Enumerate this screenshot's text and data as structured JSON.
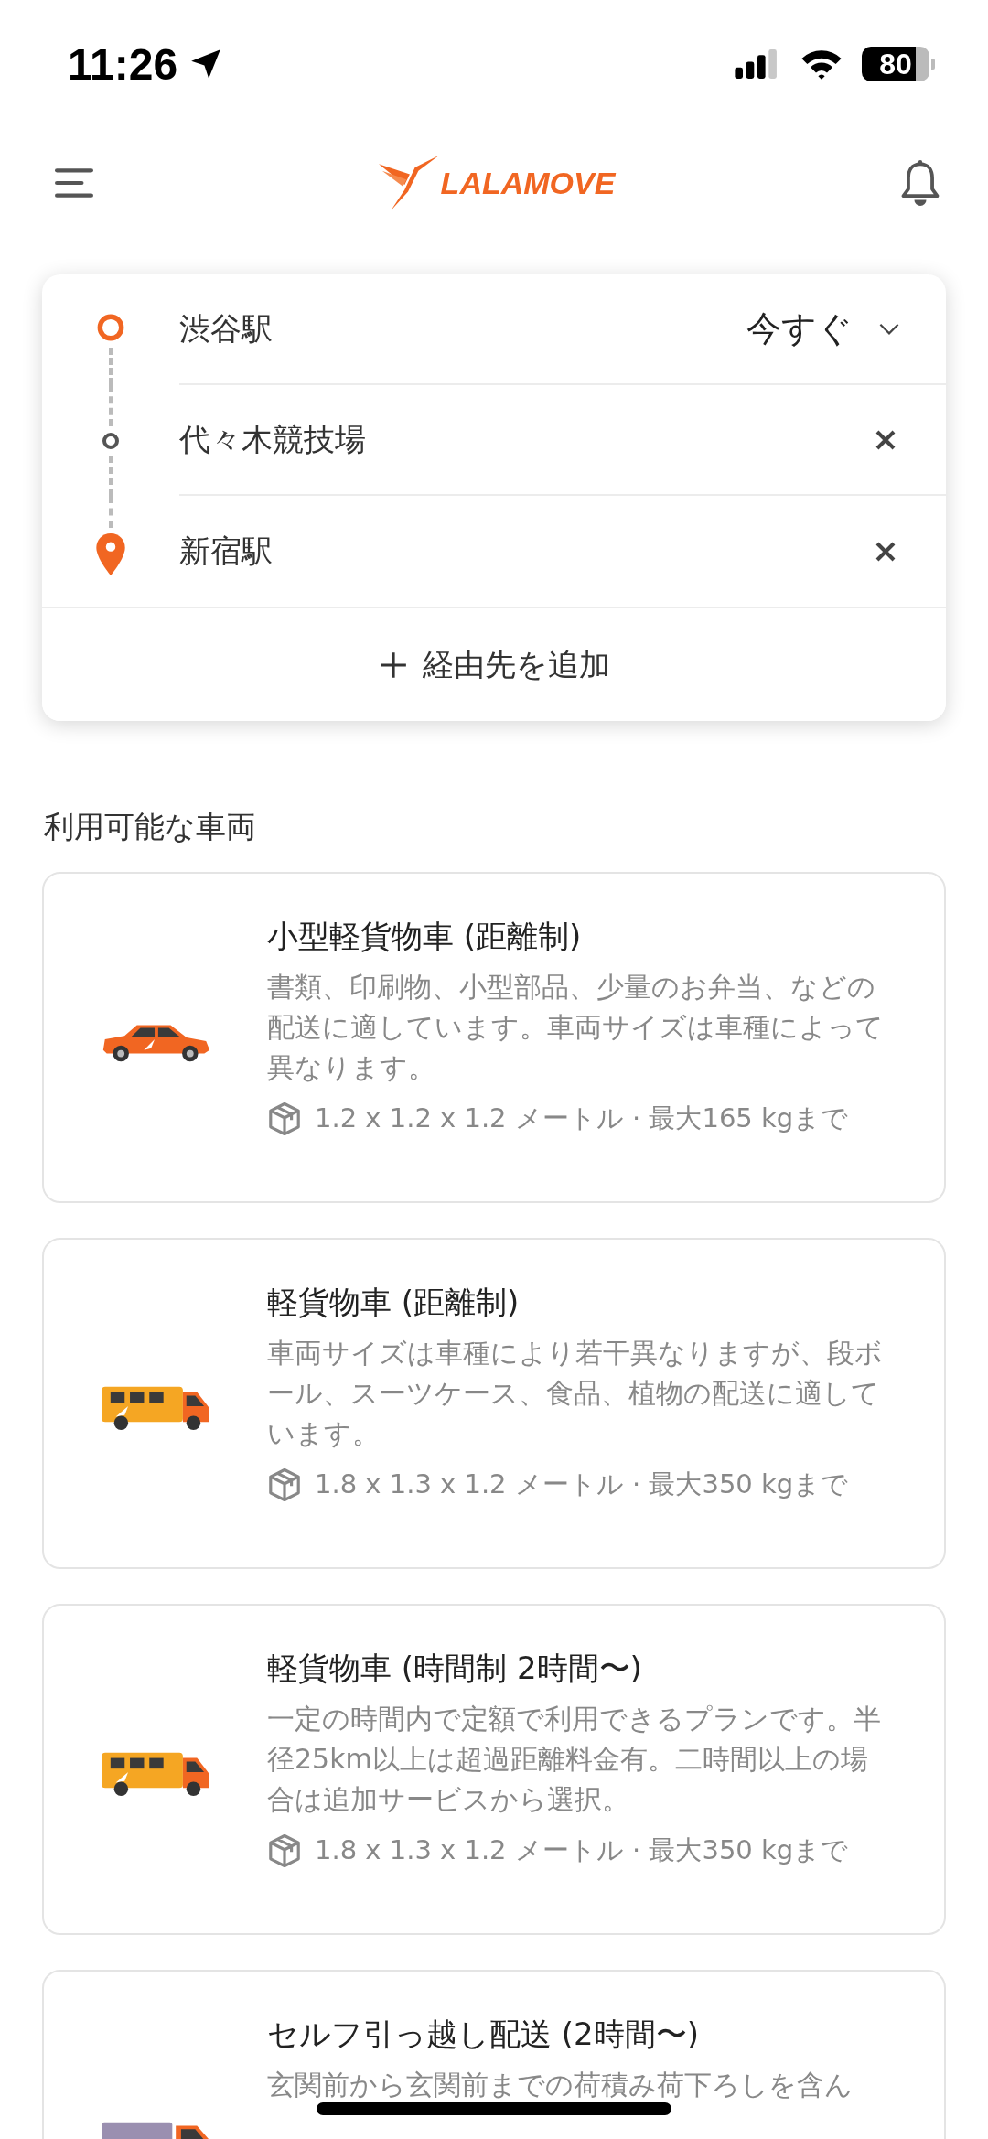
{
  "status_bar": {
    "time": "11:26",
    "battery": "80"
  },
  "header": {
    "logo": "LALAMOVE"
  },
  "route": {
    "stops": [
      {
        "kind": "pickup",
        "name": "渋谷駅"
      },
      {
        "kind": "waypoint",
        "name": "代々木競技場"
      },
      {
        "kind": "dropoff",
        "name": "新宿駅"
      }
    ],
    "time_selector": "今すぐ",
    "add_stop": "経由先を追加"
  },
  "section_title": "利用可能な車両",
  "vehicles": [
    {
      "kind": "car",
      "name": "小型軽貨物車 (距離制)",
      "description": "書類、印刷物、小型部品、少量のお弁当、などの配送に適しています。車両サイズは車種によって異なります。",
      "spec": "1.2 x 1.2 x 1.2 メートル · 最大165 kgまで"
    },
    {
      "kind": "van",
      "name": "軽貨物車 (距離制)",
      "description": "車両サイズは車種により若干異なりますが、段ボール、スーツケース、食品、植物の配送に適しています。",
      "spec": "1.8 x 1.3 x 1.2 メートル · 最大350 kgまで"
    },
    {
      "kind": "van",
      "name": "軽貨物車 (時間制 2時間〜)",
      "description": "一定の時間内で定額で利用できるプランです。半径25km以上は超過距離料金有。二時間以上の場合は追加サービスから選択。",
      "spec": "1.8 x 1.3 x 1.2 メートル · 最大350 kgまで"
    },
    {
      "kind": "truck",
      "name": "セルフ引っ越し配送 (2時間〜)",
      "description": "玄関前から玄関前までの荷積み荷下ろしを含ん"
    }
  ]
}
